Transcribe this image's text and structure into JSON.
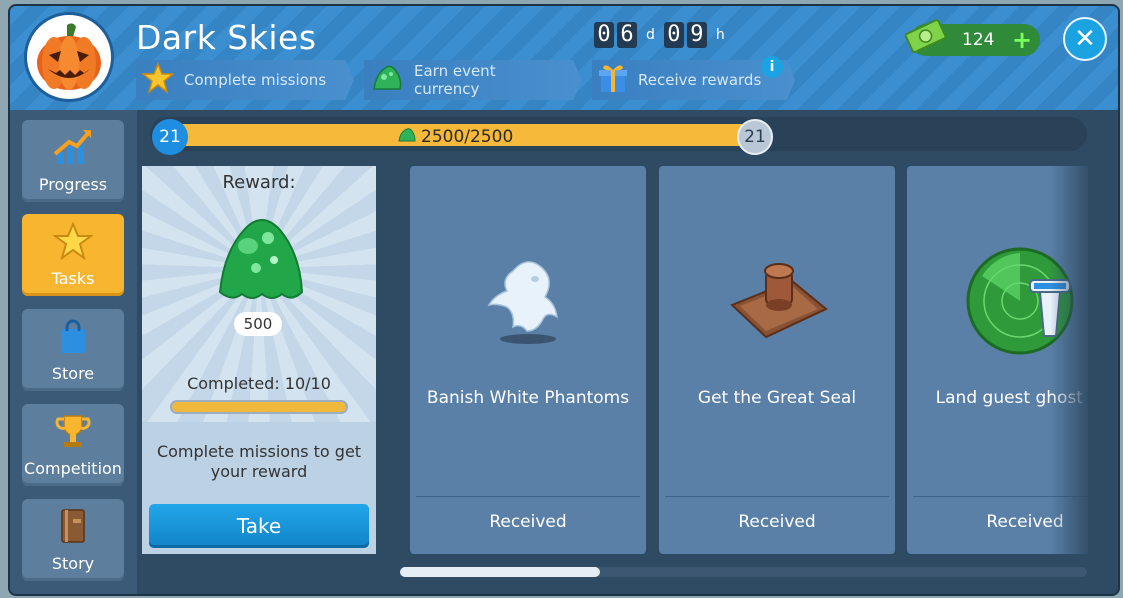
{
  "event": {
    "title": "Dark Skies",
    "timer": {
      "days_digits": [
        "0",
        "6"
      ],
      "days_unit": "d",
      "hours_digits": [
        "0",
        "9"
      ],
      "hours_unit": "h"
    },
    "goals": [
      {
        "label": "Complete missions",
        "icon": "star-icon"
      },
      {
        "label": "Earn event currency",
        "icon": "ectoplasm-icon"
      },
      {
        "label": "Receive rewards",
        "icon": "gift-icon"
      }
    ],
    "info_label": "i"
  },
  "currency": {
    "amount": "124",
    "icon": "cash-icon",
    "plus_label": "+"
  },
  "sidebar": {
    "items": [
      {
        "label": "Progress",
        "icon": "growth-chart-icon",
        "active": false
      },
      {
        "label": "Tasks",
        "icon": "star-icon",
        "active": true
      },
      {
        "label": "Store",
        "icon": "shopping-bag-icon",
        "active": false
      },
      {
        "label": "Competition",
        "icon": "trophy-icon",
        "active": false
      },
      {
        "label": "Story",
        "icon": "book-icon",
        "active": false
      }
    ]
  },
  "progress": {
    "level_current": "21",
    "level_next": "21",
    "text": "2500/2500",
    "fraction": 1.0
  },
  "reward": {
    "label": "Reward:",
    "amount": "500",
    "completed_text": "Completed: 10/10",
    "completed_fraction": 1.0,
    "note": "Complete missions to get your reward",
    "button_label": "Take"
  },
  "missions": [
    {
      "name": "Banish White Phantoms",
      "status": "Received",
      "icon": "ghost-icon"
    },
    {
      "name": "Get the Great Seal",
      "status": "Received",
      "icon": "seal-stamp-icon"
    },
    {
      "name": "Land guest ghost pla",
      "status": "Received",
      "icon": "radar-tower-icon"
    }
  ],
  "colors": {
    "accent": "#1aa3e0",
    "active_tab": "#f8b630",
    "progress_fill": "#f6b93a",
    "card": "#5a80a7"
  }
}
